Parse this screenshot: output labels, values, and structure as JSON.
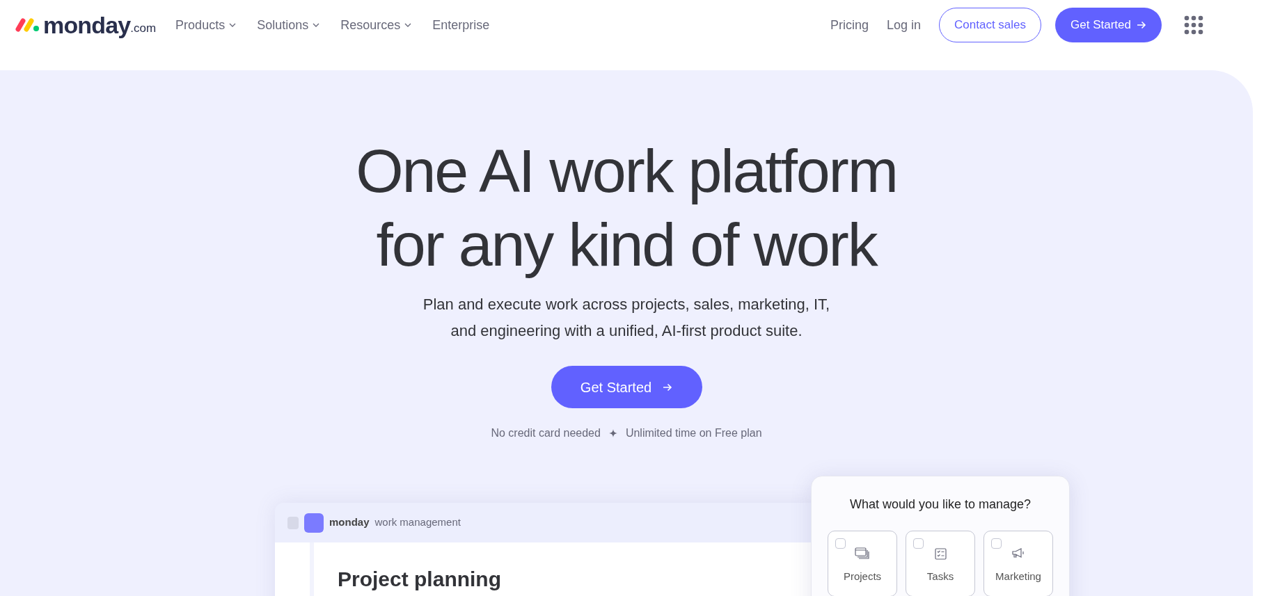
{
  "header": {
    "logo": {
      "name": "monday",
      "suffix": ".com"
    },
    "nav": [
      {
        "label": "Products",
        "dropdown": true
      },
      {
        "label": "Solutions",
        "dropdown": true
      },
      {
        "label": "Resources",
        "dropdown": true
      },
      {
        "label": "Enterprise",
        "dropdown": false
      }
    ],
    "links": [
      "Pricing",
      "Log in"
    ],
    "contact_button": "Contact sales",
    "cta_button": "Get Started"
  },
  "hero": {
    "title_lines": [
      "One AI work platform",
      "for any kind of work"
    ],
    "subtitle_lines": [
      "Plan and execute work across projects, sales, marketing, IT,",
      "and engineering with a unified, AI-first product suite."
    ],
    "cta_button": "Get Started",
    "note": [
      "No credit card needed",
      "Unlimited time on Free plan"
    ]
  },
  "preview": {
    "brand": "monday",
    "product": "work management",
    "board_title": "Project planning"
  },
  "manage_card": {
    "question": "What would you like to manage?",
    "options": [
      {
        "label": "Projects",
        "kind": "projects",
        "checked": false
      },
      {
        "label": "Tasks",
        "kind": "tasks",
        "checked": false
      },
      {
        "label": "Marketing",
        "kind": "marketing",
        "checked": false
      }
    ]
  }
}
